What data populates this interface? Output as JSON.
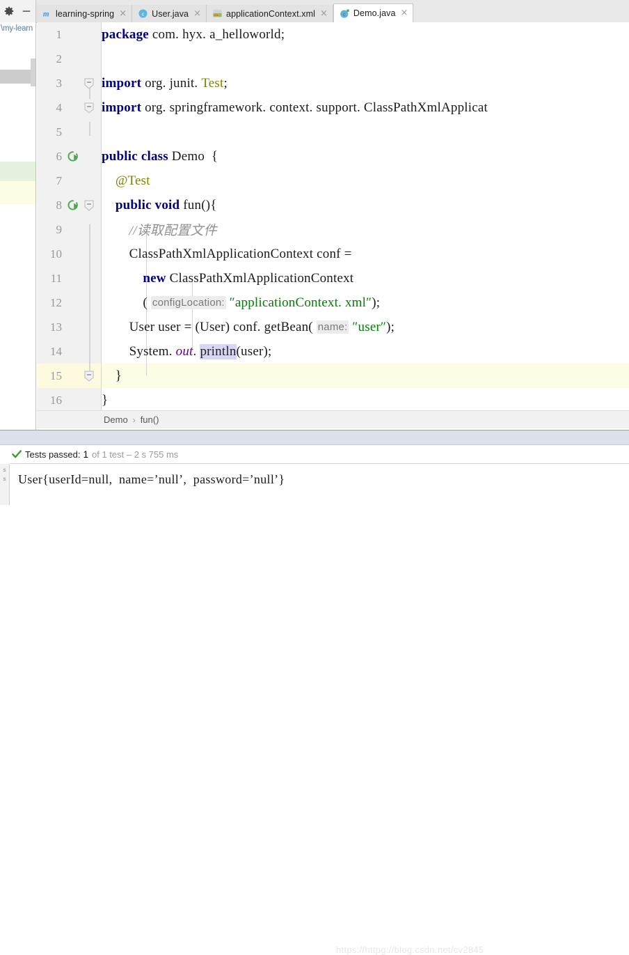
{
  "window": {
    "toolbar_icons": [
      "gear-icon",
      "minimize-icon"
    ]
  },
  "tabs": [
    {
      "label": "learning-spring",
      "icon": "maven-module-icon",
      "active": false,
      "close": "×"
    },
    {
      "label": "User.java",
      "icon": "java-class-icon",
      "active": false,
      "close": "×"
    },
    {
      "label": "applicationContext.xml",
      "icon": "spring-xml-icon",
      "active": false,
      "close": "×"
    },
    {
      "label": "Demo.java",
      "icon": "java-test-class-icon",
      "active": true,
      "close": "×"
    }
  ],
  "project_panel": {
    "path_fragment": "\\my-learn"
  },
  "editor": {
    "gutter": {
      "line_numbers": [
        "1",
        "2",
        "3",
        "4",
        "5",
        "6",
        "7",
        "8",
        "9",
        "10",
        "11",
        "12",
        "13",
        "14",
        "15",
        "16"
      ],
      "run_icons_on_lines": [
        6,
        8
      ],
      "fold_markers_on_lines": [
        3,
        4,
        8,
        15
      ]
    },
    "current_line": 14,
    "lines": [
      {
        "n": 1,
        "tokens": [
          {
            "t": "package",
            "c": "kw"
          },
          {
            "t": " com. hyx. a_helloworld;",
            "c": "plain"
          }
        ]
      },
      {
        "n": 2,
        "tokens": []
      },
      {
        "n": 3,
        "tokens": [
          {
            "t": "import",
            "c": "kw"
          },
          {
            "t": " org. junit. ",
            "c": "plain"
          },
          {
            "t": "Test",
            "c": "ann"
          },
          {
            "t": ";",
            "c": "plain"
          }
        ]
      },
      {
        "n": 4,
        "tokens": [
          {
            "t": "import",
            "c": "kw"
          },
          {
            "t": " org. springframework. context. support. ClassPathXmlApplicat",
            "c": "plain"
          }
        ]
      },
      {
        "n": 5,
        "tokens": []
      },
      {
        "n": 6,
        "tokens": [
          {
            "t": "public class",
            "c": "kw"
          },
          {
            "t": " Demo  {",
            "c": "plain"
          }
        ]
      },
      {
        "n": 7,
        "tokens": [
          {
            "t": "    ",
            "c": "plain"
          },
          {
            "t": "@Test",
            "c": "ann"
          }
        ]
      },
      {
        "n": 8,
        "tokens": [
          {
            "t": "    ",
            "c": "plain"
          },
          {
            "t": "public void",
            "c": "kw"
          },
          {
            "t": " fun(){",
            "c": "plain"
          }
        ]
      },
      {
        "n": 9,
        "tokens": [
          {
            "t": "        ",
            "c": "plain"
          },
          {
            "t": "//读取配置文件",
            "c": "cmt"
          }
        ]
      },
      {
        "n": 10,
        "tokens": [
          {
            "t": "        ClassPathXmlApplicationContext conf =",
            "c": "plain"
          }
        ]
      },
      {
        "n": 11,
        "tokens": [
          {
            "t": "            ",
            "c": "plain"
          },
          {
            "t": "new",
            "c": "kw"
          },
          {
            "t": " ClassPathXmlApplicationContext",
            "c": "plain"
          }
        ]
      },
      {
        "n": 12,
        "tokens": [
          {
            "t": "            ( ",
            "c": "plain"
          },
          {
            "t": "configLocation:",
            "c": "hint"
          },
          {
            "t": " ",
            "c": "plain"
          },
          {
            "t": "″applicationContext. xml″",
            "c": "str"
          },
          {
            "t": ");",
            "c": "plain"
          }
        ]
      },
      {
        "n": 13,
        "tokens": [
          {
            "t": "        User user = (User) conf. getBean( ",
            "c": "plain"
          },
          {
            "t": "name:",
            "c": "hint"
          },
          {
            "t": " ",
            "c": "plain"
          },
          {
            "t": "″user″",
            "c": "str"
          },
          {
            "t": ");",
            "c": "plain"
          }
        ]
      },
      {
        "n": 14,
        "tokens": [
          {
            "t": "        System. ",
            "c": "plain"
          },
          {
            "t": "out",
            "c": "stat"
          },
          {
            "t": ". ",
            "c": "plain"
          },
          {
            "t": "println",
            "c": "selhl"
          },
          {
            "t": "(user);",
            "c": "plain"
          }
        ]
      },
      {
        "n": 15,
        "tokens": [
          {
            "t": "    }",
            "c": "plain"
          }
        ]
      },
      {
        "n": 16,
        "tokens": [
          {
            "t": "}",
            "c": "plain"
          }
        ]
      }
    ]
  },
  "breadcrumb": {
    "class": "Demo",
    "separator": "›",
    "method": "fun()"
  },
  "test_results": {
    "expand_arrow": "▸",
    "check_icon": "check-icon",
    "label": "Tests passed:",
    "count": "1",
    "suffix": "of 1 test – 2 s 755 ms"
  },
  "console": {
    "rail_labels": [
      "s",
      "s"
    ],
    "output": "User{userId=null,  name=’null’,  password=’null’}"
  },
  "watermark": {
    "text": "https://httpg://blog.csdn.net/cv2845"
  },
  "colors": {
    "keyword": "#000080",
    "string": "#008000",
    "annotation": "#808000",
    "comment": "#909090",
    "static_field": "#660099",
    "current_line_bg": "#fdfce4",
    "selection_bg": "#d7d7f5",
    "run_icon_green": "#4a9c3f",
    "tab_active_bg": "#ffffff",
    "gutter_bg": "#f1f1f1"
  }
}
